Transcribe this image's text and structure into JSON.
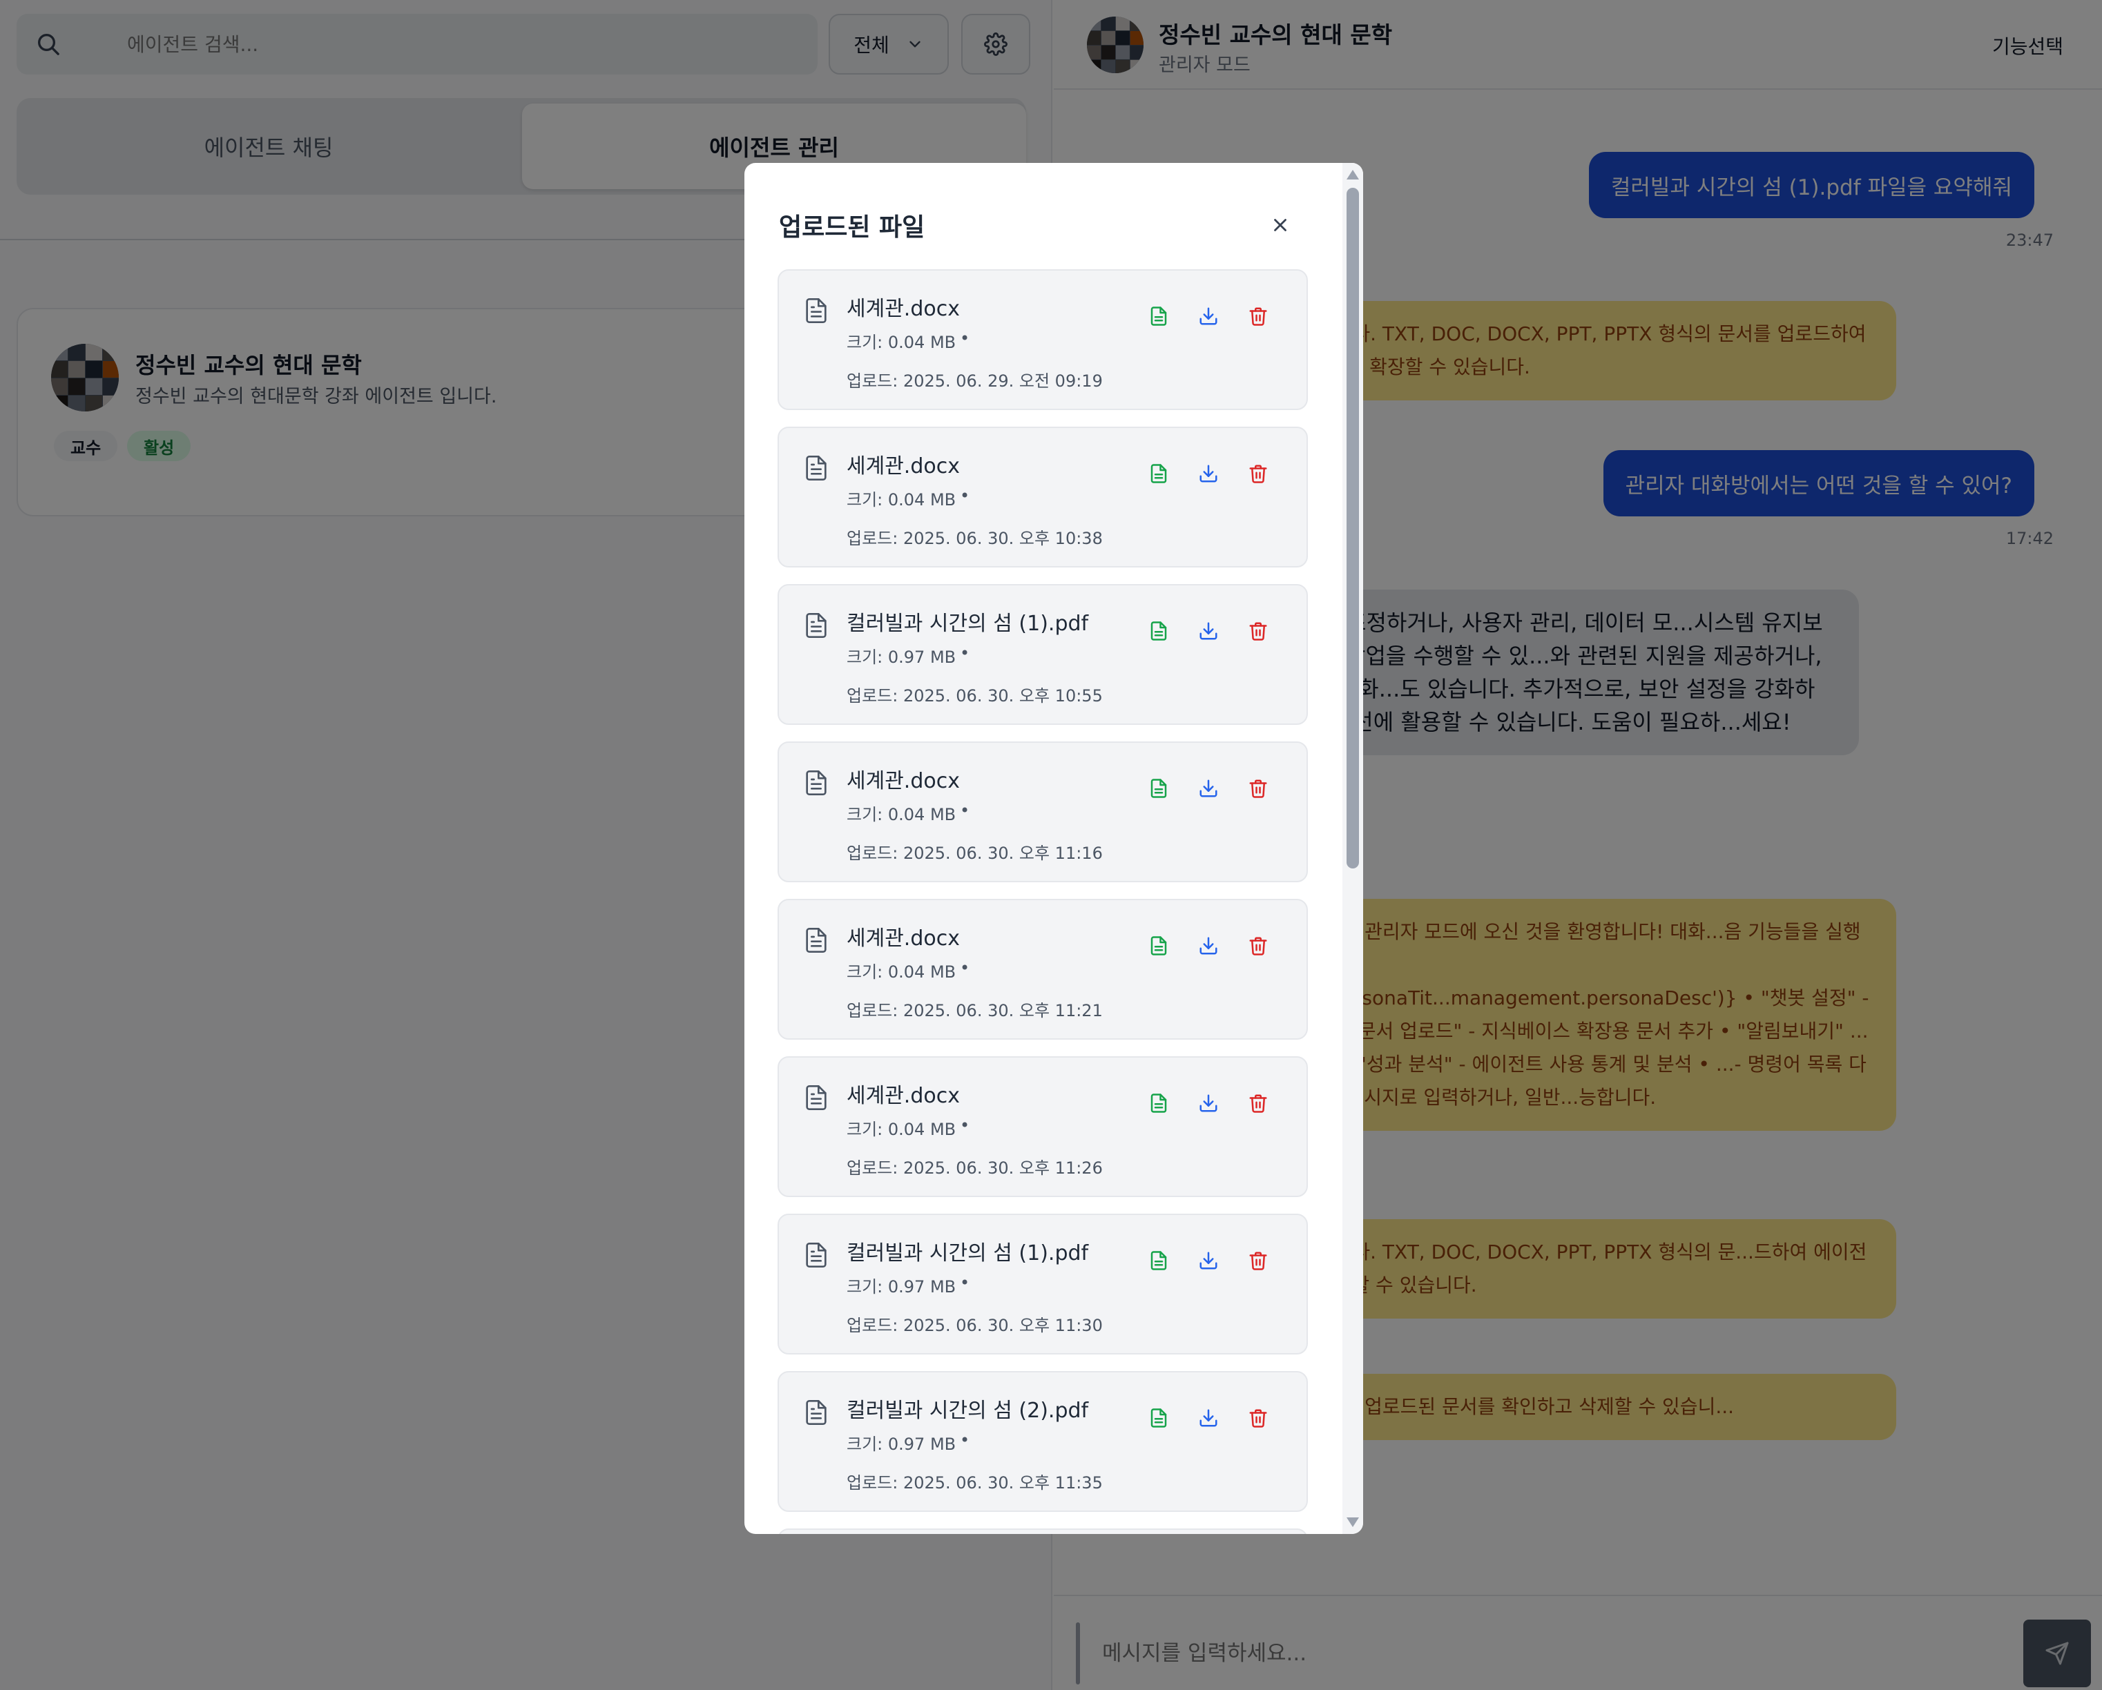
{
  "search": {
    "placeholder": "에이전트 검색..."
  },
  "filter": {
    "label": "전체"
  },
  "tabs": [
    {
      "label": "에이전트 채팅"
    },
    {
      "label": "에이전트 관리"
    }
  ],
  "agent_card": {
    "name": "정수빈 교수의 현대 문학",
    "description": "정수빈 교수의 현대문학 강좌 에이전트 입니다.",
    "badges": [
      {
        "label": "교수"
      },
      {
        "label": "활성"
      }
    ]
  },
  "chat": {
    "title": "정수빈 교수의 현대 문학",
    "subtitle": "관리자 모드",
    "menu_label": "기능선택",
    "messages": [
      {
        "type": "user",
        "text": "컬러빌과 시간의 섬 (1).pdf 파일을 요약해줘",
        "time": "23:47"
      },
      {
        "type": "system",
        "text": "...업로드 창을 열었습니다. TXT, DOC, DOCX, PPT, PPTX 형식의 문서를 업로드하여 에이전트의 지식베이스를 확장할 수 있습니다."
      },
      {
        "type": "user",
        "text": "관리자 대화방에서는 어떤 것을 할 수 있어?",
        "time": "17:42"
      },
      {
        "type": "bot",
        "text": "...로 시스템 설정을 조정하거나, 사용자 관리, 데이터 모...시스템 유지보수와 관련된 다양한 작업을 수행할 수 있...와 관련된 지원을 제공하거나, 시스템의 성능을 최적화...도 있습니다. 추가적으로, 보안 설정을 강화하거나, ...여 서비스 개선에 활용할 수 있습니다. 도움이 필요하...세요!"
      },
      {
        "type": "system",
        "text": "...수빈 교수의 현대 문학 관리자 모드에 오신 것을 환영합니다! 대화...음 기능들을 실행할 수 있습니다: • {t('management.personaTit...management.personaDesc')} • \"챗봇 설정\" - LLM 모델 및 동...경 • \"문서 업로드\" - 지식베이스 확장용 문서 추가 • \"알림보내기\" ...들에게 공지사항 전송 • \"성과 분석\" - 에이전트 사용 통계 및 분석 • ...- 명령어 목록 다시 보기 원하는 기능을 메시지로 입력하거나, 일반...능합니다."
      },
      {
        "type": "system",
        "text": "...업로드 창을 열었습니다. TXT, DOC, DOCX, PPT, PPTX 형식의 문...드하여 에이전트의 지식베이스를 확장할 수 있습니다."
      },
      {
        "type": "system",
        "text": "...관리 창을 열었습니다. 업로드된 문서를 확인하고 삭제할 수 있습니..."
      }
    ],
    "input_placeholder": "메시지를 입력하세요..."
  },
  "modal": {
    "title": "업로드된 파일",
    "files": [
      {
        "name": "세계관.docx",
        "size": "크기: 0.04 MB",
        "date": "업로드: 2025. 06. 29. 오전 09:19"
      },
      {
        "name": "세계관.docx",
        "size": "크기: 0.04 MB",
        "date": "업로드: 2025. 06. 30. 오후 10:38"
      },
      {
        "name": "컬러빌과 시간의 섬 (1).pdf",
        "size": "크기: 0.97 MB",
        "date": "업로드: 2025. 06. 30. 오후 10:55"
      },
      {
        "name": "세계관.docx",
        "size": "크기: 0.04 MB",
        "date": "업로드: 2025. 06. 30. 오후 11:16"
      },
      {
        "name": "세계관.docx",
        "size": "크기: 0.04 MB",
        "date": "업로드: 2025. 06. 30. 오후 11:21"
      },
      {
        "name": "세계관.docx",
        "size": "크기: 0.04 MB",
        "date": "업로드: 2025. 06. 30. 오후 11:26"
      },
      {
        "name": "컬러빌과 시간의 섬 (1).pdf",
        "size": "크기: 0.97 MB",
        "date": "업로드: 2025. 06. 30. 오후 11:30"
      },
      {
        "name": "컬러빌과 시간의 섬 (2).pdf",
        "size": "크기: 0.97 MB",
        "date": "업로드: 2025. 06. 30. 오후 11:35"
      }
    ],
    "separator": "•"
  },
  "colors": {
    "user_bubble": "#1d4ed8",
    "system_bubble": "#fde68a",
    "bot_bubble": "#e5e7eb",
    "view_icon": "#16a34a",
    "download_icon": "#2563eb",
    "delete_icon": "#dc2626"
  },
  "icons": {
    "search": "search-icon",
    "filter_chevron": "chevron-down-icon",
    "settings": "gear-icon",
    "close": "close-icon",
    "file": "file-icon",
    "view": "file-text-icon",
    "download": "download-icon",
    "delete": "trash-icon",
    "send": "send-icon"
  }
}
